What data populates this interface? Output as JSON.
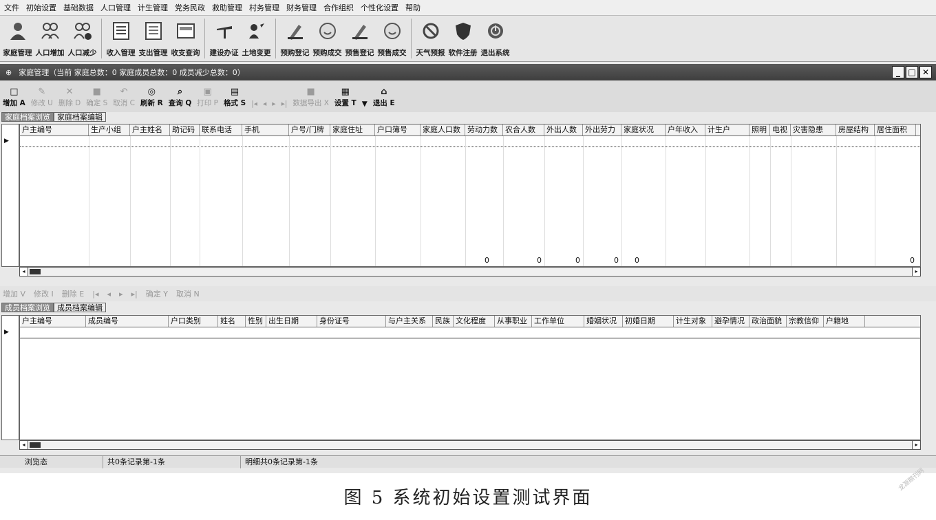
{
  "menu": [
    "文件",
    "初始设置",
    "基础数据",
    "人口管理",
    "计生管理",
    "党务民政",
    "救助管理",
    "村务管理",
    "财务管理",
    "合作组织",
    "个性化设置",
    "帮助"
  ],
  "main_toolbar": [
    {
      "label": "家庭管理",
      "icon": "family-icon"
    },
    {
      "label": "人口增加",
      "icon": "people-add-icon"
    },
    {
      "label": "人口减少",
      "icon": "people-remove-icon"
    },
    {
      "label": "收入管理",
      "icon": "income-icon"
    },
    {
      "label": "支出管理",
      "icon": "expense-icon"
    },
    {
      "label": "收支查询",
      "icon": "query-icon"
    },
    {
      "label": "建设办证",
      "icon": "build-permit-icon"
    },
    {
      "label": "土地变更",
      "icon": "land-change-icon"
    },
    {
      "label": "预购登记",
      "icon": "prepurchase-register-icon"
    },
    {
      "label": "预购成交",
      "icon": "prepurchase-deal-icon"
    },
    {
      "label": "预售登记",
      "icon": "presale-register-icon"
    },
    {
      "label": "预售成交",
      "icon": "presale-deal-icon"
    },
    {
      "label": "天气预报",
      "icon": "weather-icon"
    },
    {
      "label": "软件注册",
      "icon": "shield-icon"
    },
    {
      "label": "退出系统",
      "icon": "power-icon"
    }
  ],
  "window": {
    "title": "家庭管理（当前 家庭总数：0  家庭成员总数：0  成员减少总数：0）"
  },
  "family_toolbar": [
    {
      "label": "增加 A",
      "enabled": true,
      "icon": "□"
    },
    {
      "label": "修改 U",
      "enabled": false,
      "icon": "✎"
    },
    {
      "label": "删除 D",
      "enabled": false,
      "icon": "✕"
    },
    {
      "label": "确定 S",
      "enabled": false,
      "icon": "■"
    },
    {
      "label": "取消 C",
      "enabled": false,
      "icon": "↶"
    },
    {
      "label": "刷新 R",
      "enabled": true,
      "icon": "◎"
    },
    {
      "label": "查询 Q",
      "enabled": true,
      "icon": "⌕"
    },
    {
      "label": "打印 P",
      "enabled": false,
      "icon": "▣"
    },
    {
      "label": "格式 S",
      "enabled": true,
      "icon": "▤"
    },
    {
      "label": "|◂",
      "enabled": false,
      "icon": ""
    },
    {
      "label": "◂",
      "enabled": false,
      "icon": ""
    },
    {
      "label": "▸",
      "enabled": false,
      "icon": ""
    },
    {
      "label": "▸|",
      "enabled": false,
      "icon": ""
    },
    {
      "label": "数据导出 X",
      "enabled": false,
      "icon": "■"
    },
    {
      "label": "设置 T",
      "enabled": true,
      "icon": "▦"
    },
    {
      "label": "▼",
      "enabled": true,
      "icon": ""
    },
    {
      "label": "退出 E",
      "enabled": true,
      "icon": "⌂"
    }
  ],
  "family_tabs": [
    "家庭档案浏览",
    "家庭档案编辑"
  ],
  "family_columns": [
    "户主编号",
    "生产小组",
    "户主姓名",
    "助记码",
    "联系电话",
    "手机",
    "户号/门牌",
    "家庭住址",
    "户口簿号",
    "家庭人口数",
    "劳动力数",
    "农合人数",
    "外出人数",
    "外出劳力",
    "家庭状况",
    "户年收入",
    "计生户",
    "照明",
    "电视",
    "灾害隐患",
    "房屋结构",
    "居住面积"
  ],
  "family_totals": [
    "0",
    "0",
    "0",
    "0",
    "0",
    "0"
  ],
  "member_toolbar": [
    "增加 V",
    "修改 I",
    "删除 E",
    "|◂",
    "◂",
    "▸",
    "▸|",
    "确定 Y",
    "取消 N"
  ],
  "member_tabs": [
    "成员档案浏览",
    "成员档案编辑"
  ],
  "member_columns": [
    "户主编号",
    "成员编号",
    "户口类别",
    "姓名",
    "性别",
    "出生日期",
    "身份证号",
    "与户主关系",
    "民族",
    "文化程度",
    "从事职业",
    "工作单位",
    "婚姻状况",
    "初婚日期",
    "计生对象",
    "避孕情况",
    "政治面貌",
    "宗教信仰",
    "户籍地"
  ],
  "status": [
    "浏览态",
    "共0条记录第-1条",
    "明细共0条记录第-1条"
  ],
  "caption": "图 5   系统初始设置测试界面",
  "watermark": "龙源期刊网"
}
